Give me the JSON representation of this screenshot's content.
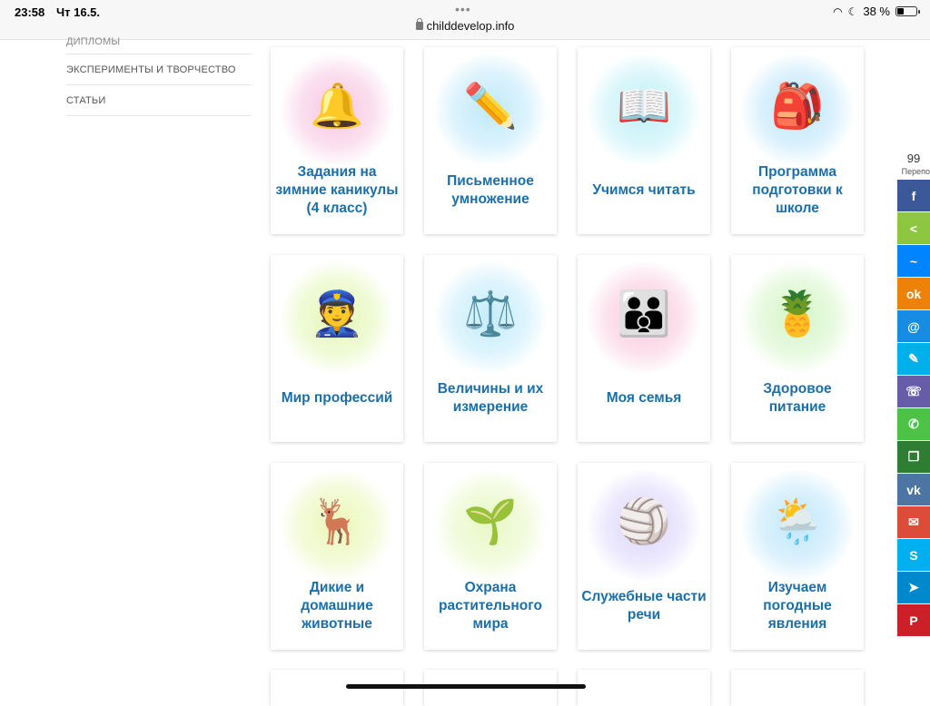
{
  "status": {
    "time": "23:58",
    "date": "Чт 16.5.",
    "url": "childdevelop.info",
    "battery": "38 %",
    "battery_level": 0.38
  },
  "sidebar": {
    "items": [
      {
        "label": "ДИПЛОМЫ"
      },
      {
        "label": "ЭКСПЕРИМЕНТЫ И ТВОРЧЕСТВО"
      },
      {
        "label": "СТАТЬИ"
      }
    ]
  },
  "cards": [
    {
      "title": "Задания на зимние каникулы (4 класс)",
      "icon": "christmas-bells-icon",
      "glyph": "🔔",
      "glow": "#f7c6e0"
    },
    {
      "title": "Письменное умножение",
      "icon": "math-pencil-icon",
      "glyph": "✏️",
      "glow": "#bfe9fb"
    },
    {
      "title": "Учимся читать",
      "icon": "open-book-icon",
      "glyph": "📖",
      "glow": "#bff0f7"
    },
    {
      "title": "Программа подготовки к школе",
      "icon": "school-backpack-icon",
      "glyph": "🎒",
      "glow": "#bde6fb"
    },
    {
      "title": "Мир профессий",
      "icon": "professions-icon",
      "glyph": "👮",
      "glow": "#e3f7b4"
    },
    {
      "title": "Величины и их измерение",
      "icon": "scales-icon",
      "glyph": "⚖️",
      "glow": "#c4ecfb"
    },
    {
      "title": "Моя семья",
      "icon": "family-icon",
      "glyph": "👪",
      "glow": "#f9c9dd"
    },
    {
      "title": "Здоровое питание",
      "icon": "fruit-basket-icon",
      "glyph": "🍍",
      "glow": "#d5f5c6"
    },
    {
      "title": "Дикие и домашние животные",
      "icon": "moose-rooster-icon",
      "glyph": "🦌",
      "glow": "#eaf7b8"
    },
    {
      "title": "Охрана растительного мира",
      "icon": "snowdrop-flower-icon",
      "glyph": "🌱",
      "glow": "#e8f8c4"
    },
    {
      "title": "Служебные части речи",
      "icon": "ball-cube-icon",
      "glyph": "🏐",
      "glow": "#dcd5fb"
    },
    {
      "title": "Изучаем погодные явления",
      "icon": "weather-cloud-icon",
      "glyph": "🌦️",
      "glow": "#bfe7fb"
    }
  ],
  "share": {
    "count": "99",
    "label": "Перепо",
    "buttons": [
      {
        "name": "facebook",
        "glyph": "f",
        "color": "#3b5998"
      },
      {
        "name": "share",
        "glyph": "<",
        "color": "#8dc63f"
      },
      {
        "name": "messenger",
        "glyph": "~",
        "color": "#0084ff"
      },
      {
        "name": "odnoklassniki",
        "glyph": "ok",
        "color": "#ee8208"
      },
      {
        "name": "mail-ru",
        "glyph": "@",
        "color": "#168de2"
      },
      {
        "name": "livejournal",
        "glyph": "✎",
        "color": "#00b0ea"
      },
      {
        "name": "viber",
        "glyph": "☏",
        "color": "#665ca7"
      },
      {
        "name": "whatsapp",
        "glyph": "✆",
        "color": "#4dc247"
      },
      {
        "name": "copy",
        "glyph": "❐",
        "color": "#2e7d32"
      },
      {
        "name": "vkontakte",
        "glyph": "vk",
        "color": "#4c75a3"
      },
      {
        "name": "email",
        "glyph": "✉",
        "color": "#dd4b39"
      },
      {
        "name": "skype",
        "glyph": "S",
        "color": "#00aff0"
      },
      {
        "name": "telegram",
        "glyph": "➤",
        "color": "#0088cc"
      },
      {
        "name": "pinterest",
        "glyph": "P",
        "color": "#cb2027"
      }
    ]
  }
}
